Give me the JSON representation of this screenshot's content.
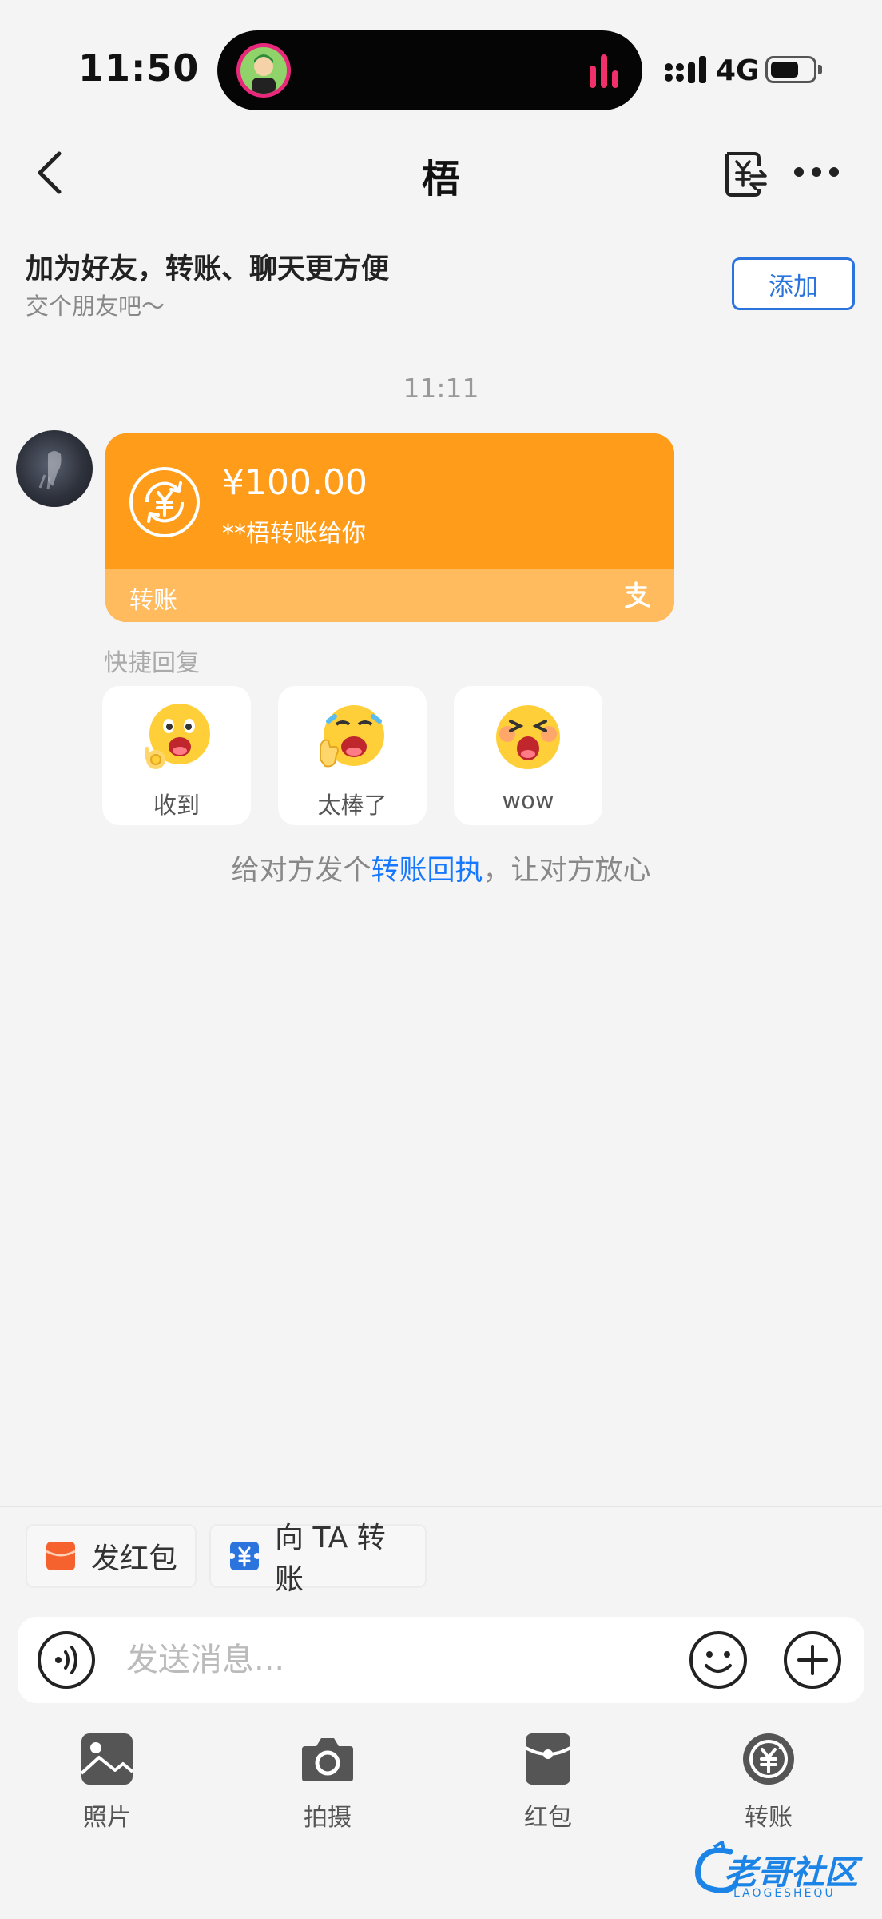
{
  "status_bar": {
    "time": "11:50",
    "network": "4G"
  },
  "header": {
    "title": "梧"
  },
  "friend_banner": {
    "title": "加为好友，转账、聊天更方便",
    "subtitle": "交个朋友吧～",
    "add_label": "添加"
  },
  "chat": {
    "timestamp": "11:11",
    "transfer_card": {
      "amount": "¥100.00",
      "description": "**梧转账给你",
      "label": "转账"
    },
    "quick_reply": {
      "title": "快捷回复",
      "items": [
        {
          "label": "收到",
          "icon": "ok-emoji-icon"
        },
        {
          "label": "太棒了",
          "icon": "thumbs-up-emoji-icon"
        },
        {
          "label": "wow",
          "icon": "wow-emoji-icon"
        }
      ]
    },
    "receipt_hint": {
      "prefix": "给对方发个",
      "link": "转账回执",
      "suffix": "，让对方放心"
    }
  },
  "chips": {
    "red_packet": "发红包",
    "transfer": "向 TA 转账"
  },
  "input": {
    "placeholder": "发送消息..."
  },
  "toolbar": [
    {
      "label": "照片",
      "icon": "photo-icon"
    },
    {
      "label": "拍摄",
      "icon": "camera-icon"
    },
    {
      "label": "红包",
      "icon": "red-packet-icon"
    },
    {
      "label": "转账",
      "icon": "transfer-icon"
    }
  ],
  "watermark": {
    "text": "老哥社区",
    "sub": "LAOGESHEQU"
  },
  "colors": {
    "accent_blue": "#1677ff",
    "card_orange": "#ff9c19",
    "card_orange_light": "#ffbb5e",
    "red_packet": "#f5622e"
  }
}
